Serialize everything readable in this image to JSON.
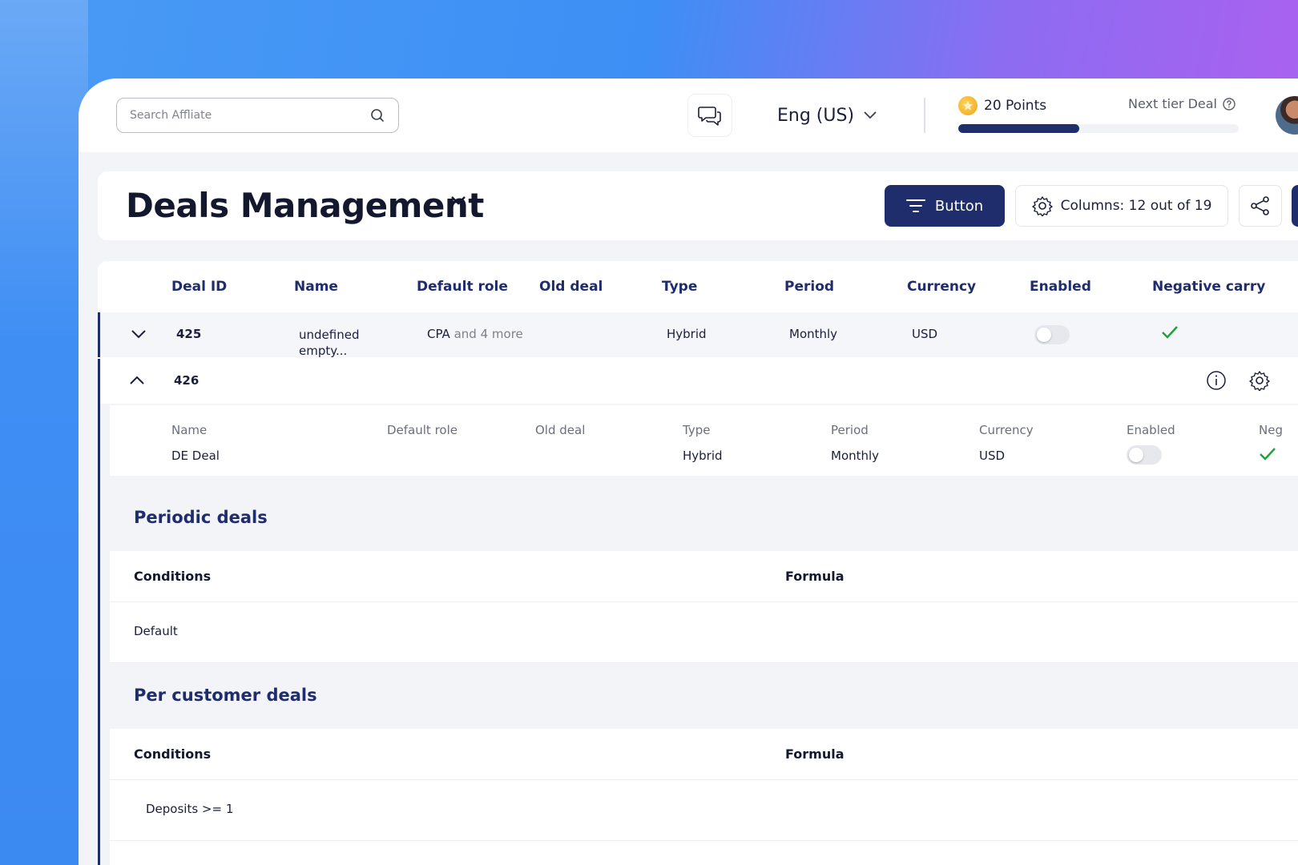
{
  "topbar": {
    "search_placeholder": "Search Affliate",
    "language": "Eng (US)",
    "points_label": "20 Points",
    "next_tier_label": "Next tier Deal",
    "progress": 0.43
  },
  "header": {
    "title": "Deals Management",
    "primary_button_label": "Button",
    "columns_button_label": "Columns: 12 out of 19"
  },
  "table": {
    "columns": [
      "Deal ID",
      "Name",
      "Default role",
      "Old deal",
      "Type",
      "Period",
      "Currency",
      "Enabled",
      "Negative carry"
    ],
    "rows": [
      {
        "deal_id": "425",
        "name": "undefined empty...",
        "default_role_main": "CPA",
        "default_role_more": "and 4 more",
        "old_deal": "",
        "type": "Hybrid",
        "period": "Monthly",
        "currency": "USD",
        "enabled": false,
        "negative_carry": true
      },
      {
        "deal_id": "426",
        "details": {
          "labels": [
            "Name",
            "Default role",
            "Old deal",
            "Type",
            "Period",
            "Currency",
            "Enabled",
            "Neg"
          ],
          "name": "DE Deal",
          "type": "Hybrid",
          "period": "Monthly",
          "currency": "USD",
          "enabled": false,
          "negative_carry": true
        }
      }
    ]
  },
  "periodic_deals": {
    "title": "Periodic deals",
    "conditions_header": "Conditions",
    "formula_header": "Formula",
    "rows": [
      {
        "condition": "Default"
      }
    ]
  },
  "per_customer_deals": {
    "title": "Per customer deals",
    "conditions_header": "Conditions",
    "formula_header": "Formula",
    "rows": [
      {
        "condition": "Deposits >= 1"
      }
    ]
  },
  "colors": {
    "brand_navy": "#1f2d6d",
    "check_green": "#1aa33a",
    "coin_gold": "#f0a51c"
  }
}
